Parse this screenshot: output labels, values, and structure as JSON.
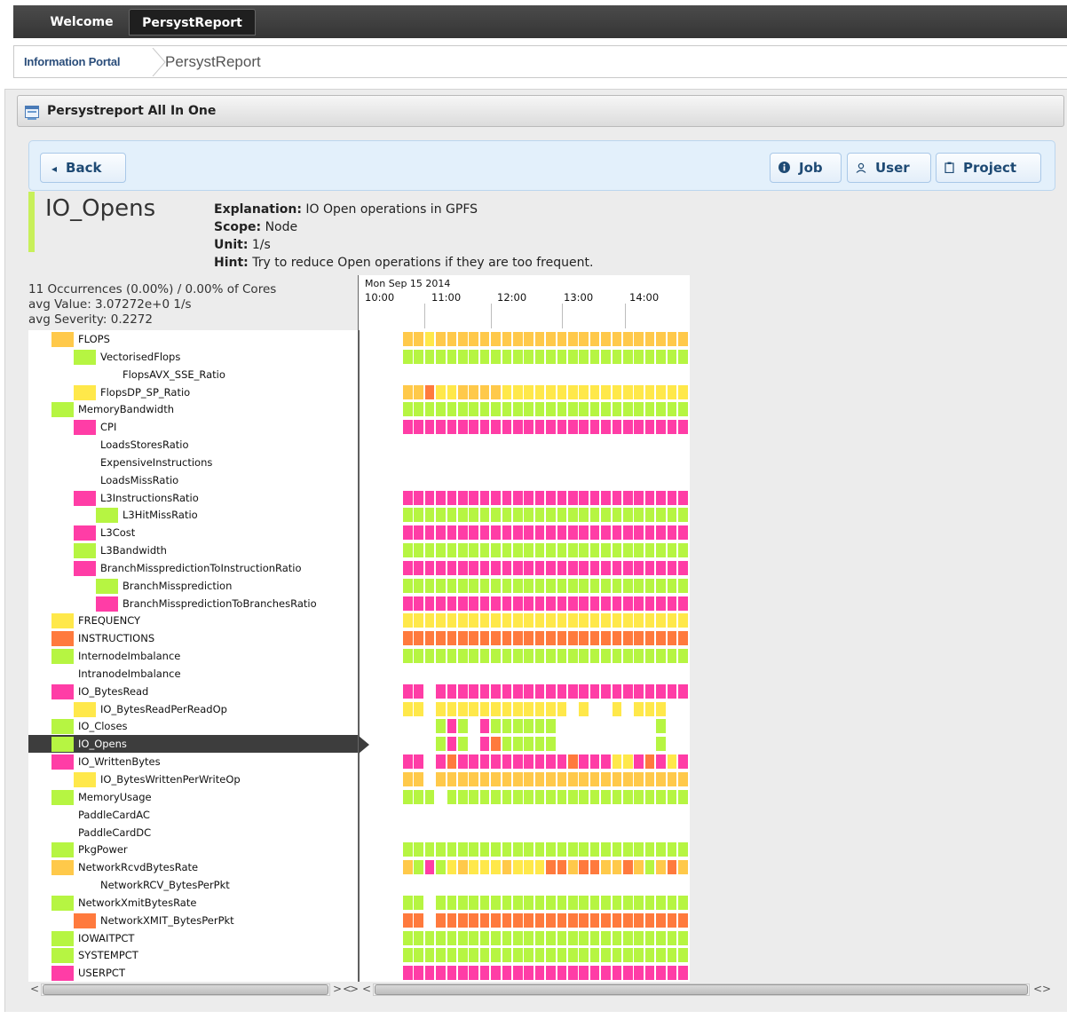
{
  "tabs": [
    {
      "label": "Welcome",
      "active": false
    },
    {
      "label": "PersystReport",
      "active": true
    }
  ],
  "breadcrumb": {
    "root": "Information Portal",
    "current": "PersystReport"
  },
  "panel": {
    "title": "Persystreport All In One"
  },
  "toolbar": {
    "back": "Back",
    "job": "Job",
    "user": "User",
    "project": "Project"
  },
  "metric": {
    "name": "IO_Opens",
    "explanation_label": "Explanation:",
    "explanation": "IO Open operations in GPFS",
    "scope_label": "Scope:",
    "scope": "Node",
    "unit_label": "Unit:",
    "unit": "1/s",
    "hint_label": "Hint:",
    "hint": "Try to reduce Open operations if they are too frequent."
  },
  "stats": {
    "occurrences": "11 Occurrences (0.00%) / 0.00% of Cores",
    "avg_value": "avg Value: 3.07272e+0 1/s",
    "avg_severity": "avg Severity: 0.2272"
  },
  "timeline": {
    "date": "Mon Sep 15 2014",
    "ticks": [
      "10:00",
      "11:00",
      "12:00",
      "13:00",
      "14:00"
    ]
  },
  "colors": {
    "Y": "#ffe84a",
    "O": "#ffc94a",
    "G": "#b6f542",
    "P": "#ff3da6",
    "R": "#ff7a3d",
    "selected_row": "#3d3d3d"
  },
  "tree": [
    {
      "label": "FLOPS",
      "indent": 0,
      "color": "O",
      "cells": "OOYOOOOOOOOOOOOOOOOOOOOOOO"
    },
    {
      "label": "VectorisedFlops",
      "indent": 1,
      "color": "G",
      "cells": "GGGGGGGGGGGGGGGGGGGGGGGGGG"
    },
    {
      "label": "FlopsAVX_SSE_Ratio",
      "indent": 2,
      "color": "",
      "cells": ""
    },
    {
      "label": "FlopsDP_SP_Ratio",
      "indent": 1,
      "color": "Y",
      "cells": "OORYYOOOOYYYYYYYYYYYYYYYYY"
    },
    {
      "label": "MemoryBandwidth",
      "indent": 0,
      "color": "G",
      "cells": "GGGGGGGGGGGGGGGGGGGGGGGGGG"
    },
    {
      "label": "CPI",
      "indent": 1,
      "color": "P",
      "cells": "PPPPPPPPPPPPPPPPPPPPPPPPPP"
    },
    {
      "label": "LoadsStoresRatio",
      "indent": 1,
      "color": "",
      "cells": ""
    },
    {
      "label": "ExpensiveInstructions",
      "indent": 1,
      "color": "",
      "cells": ""
    },
    {
      "label": "LoadsMissRatio",
      "indent": 1,
      "color": "",
      "cells": ""
    },
    {
      "label": "L3InstructionsRatio",
      "indent": 1,
      "color": "P",
      "cells": "PPPPPPPPPPPPPPPPPPPPPPPPPP"
    },
    {
      "label": "L3HitMissRatio",
      "indent": 2,
      "color": "G",
      "cells": "GGGGGGGGGGGGGGGGGGGGGGGGGG"
    },
    {
      "label": "L3Cost",
      "indent": 1,
      "color": "P",
      "cells": "PPPPPPPPPPPPPPPPPPPPPPPPPP"
    },
    {
      "label": "L3Bandwidth",
      "indent": 1,
      "color": "G",
      "cells": "GGGGGGGGGGGGGGGGGGGGGGGGGG"
    },
    {
      "label": "BranchMisspredictionToInstructionRatio",
      "indent": 1,
      "color": "P",
      "cells": "PPPPPPPPPPPPPPPPPPPPPPPPPP"
    },
    {
      "label": "BranchMissprediction",
      "indent": 2,
      "color": "G",
      "cells": "GGGGGGGGGGGGGGGGGGGGGGGGGG"
    },
    {
      "label": "BranchMisspredictionToBranchesRatio",
      "indent": 2,
      "color": "P",
      "cells": "PPPPPPPPPPPPPPPPPPPPPPPPPP"
    },
    {
      "label": "FREQUENCY",
      "indent": 0,
      "color": "Y",
      "cells": "YYYYYYYYYYYYYYYYYYYYYYYYYY"
    },
    {
      "label": "INSTRUCTIONS",
      "indent": 0,
      "color": "R",
      "cells": "RRRRRRRRRRRRRRRRRRRRRRRRRR"
    },
    {
      "label": "InternodeImbalance",
      "indent": 0,
      "color": "G",
      "cells": "GGGGGGGGGGGGGGGGGGGGGGGGGG"
    },
    {
      "label": "IntranodeImbalance",
      "indent": 0,
      "color": "",
      "cells": ""
    },
    {
      "label": "IO_BytesRead",
      "indent": 0,
      "color": "P",
      "cells": "PP.PPPPPPPPPPPPPPPPPPPPPPP"
    },
    {
      "label": "IO_BytesReadPerReadOp",
      "indent": 1,
      "color": "Y",
      "cells": "YY.YYYYYYYYYYYY.Y..Y.YYY.."
    },
    {
      "label": "IO_Closes",
      "indent": 0,
      "color": "G",
      "cells": "...GPG.PGGGGGG.........G.."
    },
    {
      "label": "IO_Opens",
      "indent": 0,
      "color": "G",
      "cells": "...GPG.PRGGGGG.........G..",
      "selected": true
    },
    {
      "label": "IO_WrittenBytes",
      "indent": 0,
      "color": "P",
      "cells": "PP.PRPPPPPPPPPPRPPPYYPRPYP"
    },
    {
      "label": "IO_BytesWrittenPerWriteOp",
      "indent": 1,
      "color": "Y",
      "cells": "OO.OOOOOOOOOOOOOOOOOOOOOOO"
    },
    {
      "label": "MemoryUsage",
      "indent": 0,
      "color": "G",
      "cells": "GGG.GGGGGGGGGGGGGGGGGGGGGG"
    },
    {
      "label": "PaddleCardAC",
      "indent": 0,
      "color": "",
      "cells": ""
    },
    {
      "label": "PaddleCardDC",
      "indent": 0,
      "color": "",
      "cells": ""
    },
    {
      "label": "PkgPower",
      "indent": 0,
      "color": "G",
      "cells": "GGGGGGGGGGGGGGGGGGGGGGGGGG"
    },
    {
      "label": "NetworkRcvdBytesRate",
      "indent": 0,
      "color": "O",
      "cells": "OGPGYOYYYOYYYRRORROOROGOROO"
    },
    {
      "label": "NetworkRCV_BytesPerPkt",
      "indent": 1,
      "color": "",
      "cells": ""
    },
    {
      "label": "NetworkXmitBytesRate",
      "indent": 0,
      "color": "G",
      "cells": "GG.GGGGGGGGGGGGGGGGGGGGGGG"
    },
    {
      "label": "NetworkXMIT_BytesPerPkt",
      "indent": 1,
      "color": "R",
      "cells": "RR.RRRRRRRRRRRRRRRRRRRRRRR"
    },
    {
      "label": "IOWAITPCT",
      "indent": 0,
      "color": "G",
      "cells": "GGGGGGGGGGGGGGGGGGGGGGGGGG"
    },
    {
      "label": "SYSTEMPCT",
      "indent": 0,
      "color": "G",
      "cells": "GGGGGGGGGGGGGGGGGGGGGGGGGG"
    },
    {
      "label": "USERPCT",
      "indent": 0,
      "color": "P",
      "cells": "PPPPPPPPPPPPPPPPPPPPPPPPPP"
    }
  ]
}
